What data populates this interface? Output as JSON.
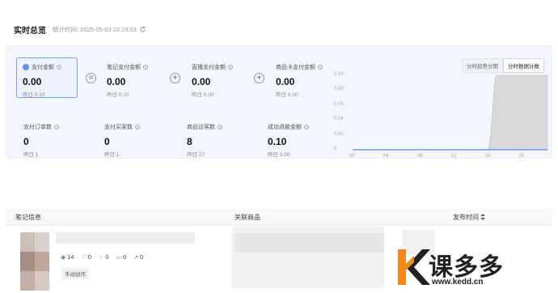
{
  "header": {
    "title": "实时总览",
    "stat_time": "统计时间: 2025-05-03 23:23:03"
  },
  "metrics_top": [
    {
      "label": "支付金额",
      "value": "0.00",
      "prev": "昨日 0.10"
    },
    {
      "label": "笔记支付金额",
      "value": "0.00",
      "prev": "昨日 0.10"
    },
    {
      "label": "直播支付金额",
      "value": "0.00",
      "prev": "昨日 0.00"
    },
    {
      "label": "商品卡支付金额",
      "value": "0.00",
      "prev": "昨日 0.00"
    }
  ],
  "metrics_bottom": [
    {
      "label": "支付订单数",
      "value": "0",
      "prev": "昨日 1"
    },
    {
      "label": "支付买家数",
      "value": "0",
      "prev": "昨日 1"
    },
    {
      "label": "商品访客数",
      "value": "8",
      "prev": "昨日 27"
    },
    {
      "label": "成功退款金额",
      "value": "0.10",
      "prev": "昨日 0.00"
    }
  ],
  "operators": [
    "=",
    "+",
    "+"
  ],
  "chart_tabs": [
    {
      "label": "分时趋势分图",
      "active": false
    },
    {
      "label": "分时数据计数",
      "active": true
    }
  ],
  "colors": {
    "accent": "#6b8ff2",
    "line": "#5b7ff0",
    "area": "#d4d4d4"
  },
  "chart_data": {
    "type": "line",
    "x": [
      0,
      4,
      8,
      12,
      16,
      17,
      20,
      23
    ],
    "series": [
      {
        "values": [
          0,
          0,
          0,
          0,
          0,
          0,
          0,
          0
        ]
      },
      {
        "values": [
          0,
          0,
          0,
          0,
          0,
          0.1,
          0.1,
          0.1
        ]
      }
    ],
    "x_ticks": [
      "00",
      "04",
      "08",
      "12",
      "16",
      "20"
    ],
    "y_ticks": [
      "0.10",
      "0.08",
      "0.06",
      "0.04",
      "0.02",
      "0"
    ],
    "ylim": [
      0,
      0.1
    ],
    "xlim": [
      0,
      23
    ]
  },
  "table": {
    "columns": [
      "笔记信息",
      "关联商品",
      "发布时间"
    ],
    "sort_icon": "sort-icon"
  },
  "row": {
    "views": "14",
    "likes": "0",
    "collects": "0",
    "comments": "0",
    "shares": "0",
    "tag": "手动创作"
  },
  "watermark": {
    "brand": "课多多",
    "url": "www.kedd.cn"
  }
}
